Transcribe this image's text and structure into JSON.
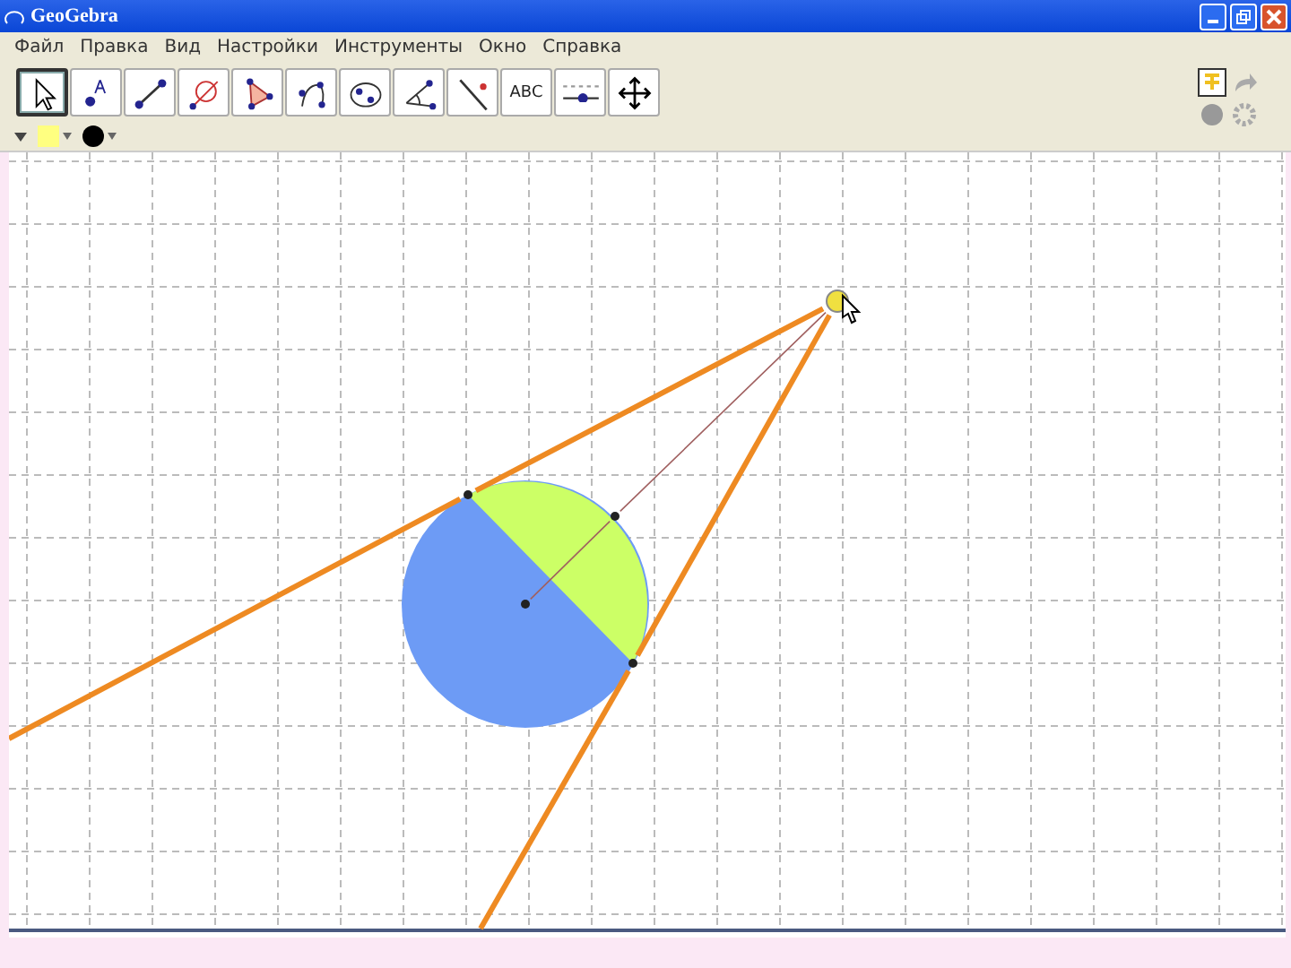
{
  "window": {
    "title": "GeoGebra"
  },
  "menu": [
    "Файл",
    "Правка",
    "Вид",
    "Настройки",
    "Инструменты",
    "Окно",
    "Справка"
  ],
  "tools": [
    {
      "kind": "move",
      "selected": true
    },
    {
      "kind": "point",
      "selected": false
    },
    {
      "kind": "segment",
      "selected": false
    },
    {
      "kind": "circle",
      "selected": false
    },
    {
      "kind": "polygon",
      "selected": false
    },
    {
      "kind": "curve",
      "selected": false
    },
    {
      "kind": "conic",
      "selected": false
    },
    {
      "kind": "angle",
      "selected": false
    },
    {
      "kind": "line",
      "selected": false
    },
    {
      "kind": "text",
      "label": "ABC",
      "selected": false
    },
    {
      "kind": "slider",
      "selected": false
    },
    {
      "kind": "pan",
      "selected": false
    }
  ],
  "style_swatches": [
    {
      "kind": "fill",
      "color": "#ffff80"
    },
    {
      "kind": "point",
      "color": "#000000"
    }
  ]
}
